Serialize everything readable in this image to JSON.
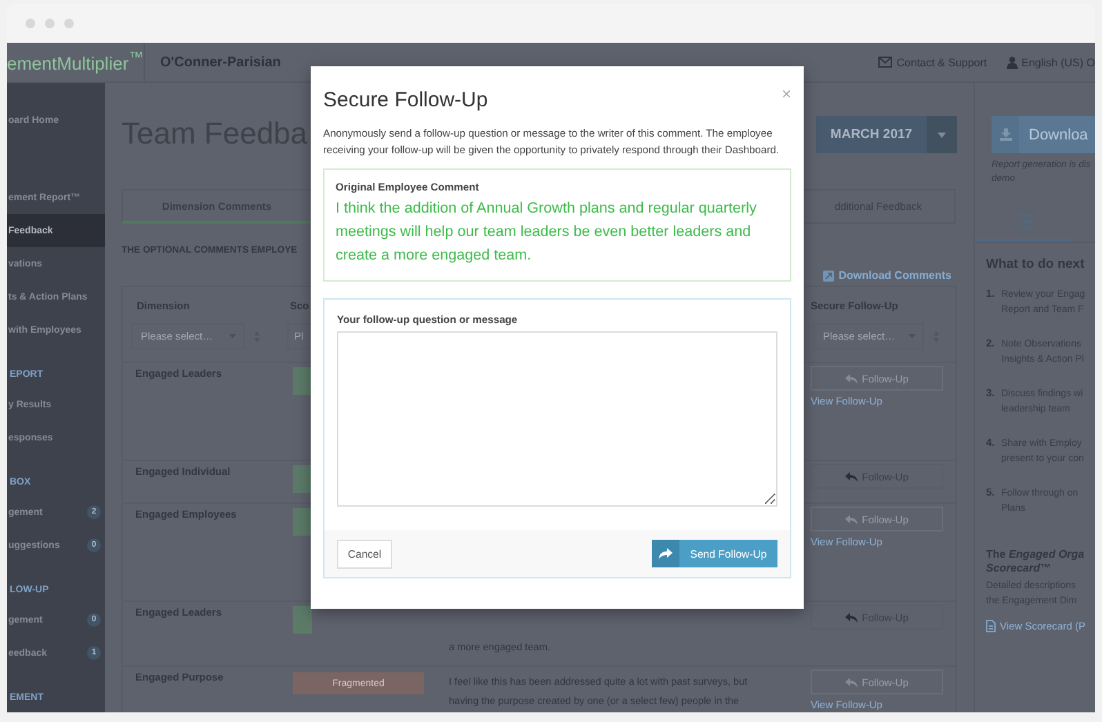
{
  "header": {
    "logo": "ementMultiplier$^{™}$",
    "company": "O'Conner-Parisian",
    "links": [
      {
        "kind": "support",
        "label": "Contact & Support"
      },
      {
        "kind": "language",
        "label": "English (US) O"
      }
    ]
  },
  "sidebar": {
    "groups": [
      {
        "items": [
          {
            "label": "oard Home",
            "selected": false
          }
        ]
      },
      {
        "items": [
          {
            "label": "ement Report™",
            "selected": false
          },
          {
            "label": "Feedback",
            "selected": true
          },
          {
            "label": "vations",
            "selected": false
          },
          {
            "label": "ts & Action Plans",
            "selected": false
          },
          {
            "label": " with Employees",
            "selected": false
          }
        ]
      },
      {
        "title": "EPORT",
        "items": [
          {
            "label": "y Results",
            "selected": false
          },
          {
            "label": "esponses",
            "selected": false
          }
        ]
      },
      {
        "title": "BOX",
        "items": [
          {
            "label": "gement",
            "selected": false,
            "badge": "2"
          },
          {
            "label": "uggestions",
            "selected": false,
            "badge": "0"
          }
        ]
      },
      {
        "title": "LOW-UP",
        "items": [
          {
            "label": "gement",
            "selected": false,
            "badge": "0"
          },
          {
            "label": "eedback",
            "selected": false,
            "badge": "1"
          }
        ]
      },
      {
        "title": "EMENT"
      }
    ]
  },
  "page": {
    "title": "Team Feedba",
    "month": "MARCH 2017"
  },
  "tabs": [
    {
      "label": "Dimension Comments",
      "selected": true
    },
    {
      "label": "dditional Feedback",
      "selected": false
    }
  ],
  "intro": "THE OPTIONAL COMMENTS EMPLOYE",
  "download_link": "Download Comments",
  "table": {
    "columns": [
      "Dimension",
      "Sco",
      "Secure Follow-Up"
    ],
    "filters": [
      {
        "placeholder": "Please select…"
      },
      {
        "placeholder": "Pl"
      },
      {
        "placeholder": "Please select…"
      }
    ],
    "rows": [
      {
        "dimension": "Engaged Leaders",
        "color": "#5b7a68",
        "follow_up": "Follow-Up",
        "disabled": true,
        "view_link": "View Follow-Up"
      },
      {
        "dimension": "Engaged Individual",
        "color": "#5b7a68",
        "follow_up": "Follow-Up",
        "disabled": false
      },
      {
        "dimension": "Engaged Employees",
        "color": "#5b7a68",
        "follow_up": "Follow-Up",
        "disabled": true,
        "view_link": "View Follow-Up"
      },
      {
        "dimension": "Engaged Leaders",
        "color": "#5b7a68",
        "comment_lines": [
          "a more engaged team."
        ],
        "follow_up": "Follow-Up",
        "disabled": false
      },
      {
        "dimension": "Engaged Purpose",
        "color": "#7a6562",
        "score": "Fragmented",
        "comment_lines": [
          "I feel like this has been addressed quite a lot with past surveys, but",
          "having the purpose created by one (or a select few) people in the"
        ],
        "follow_up": "Follow-Up",
        "disabled": true,
        "view_link": "View Follow-Up"
      }
    ]
  },
  "report_panel": {
    "download_button": "Downloa",
    "note_lines": [
      "Report generation is dis",
      "demo"
    ],
    "next_title": "What to do next",
    "steps": [
      {
        "number": "1.",
        "lines": [
          "Review your Engag",
          "Report and Team F"
        ]
      },
      {
        "number": "2.",
        "lines": [
          "Note Observations",
          "Insights & Action Pl"
        ]
      },
      {
        "number": "3.",
        "lines": [
          "Discuss findings wi",
          "leadership team"
        ]
      },
      {
        "number": "4.",
        "lines": [
          "Share with Employ",
          "present to your con"
        ]
      },
      {
        "number": "5.",
        "lines": [
          "Follow through on",
          "Plans"
        ]
      }
    ],
    "scorecard_title": [
      "The *Engaged Orga*",
      "*Scorecard*™"
    ],
    "scorecard_lines": [
      "Detailed descriptions",
      "the Engagement Dim"
    ],
    "scorecard_link": "View Scorecard (P"
  },
  "modal": {
    "title": "Secure Follow-Up",
    "close": "×",
    "description": "Anonymously send a follow-up question or message to the writer of this comment. The employee receiving your follow-up will be given the opportunity to privately respond through their Dashboard.",
    "comment_label": "Original Employee Comment",
    "comment": "I think the addition of Annual Growth plans and regular quarterly meetings will help our team leaders be even better leaders and create a more engaged team.",
    "message_label": "Your follow-up question or message",
    "cancel": "Cancel",
    "send": "Send Follow-Up"
  }
}
